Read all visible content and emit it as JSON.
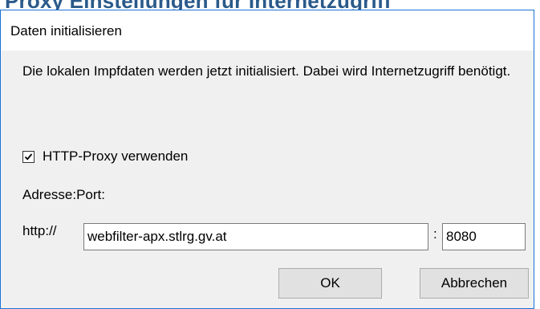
{
  "background": {
    "heading": "Proxy Einstellungen für Internetzugriff"
  },
  "dialog": {
    "title": "Daten initialisieren",
    "message": "Die lokalen Impfdaten werden jetzt initialisiert. Dabei wird Internetzugriff benötigt.",
    "proxy_checkbox": {
      "label": "HTTP-Proxy verwenden",
      "checked": true
    },
    "address_label": "Adresse:Port:",
    "scheme_label": "http://",
    "host_value": "webfilter-apx.stlrg.gv.at",
    "port_separator": ":",
    "port_value": "8080",
    "ok_label": "OK",
    "cancel_label": "Abbrechen"
  },
  "colors": {
    "dialog_border": "#1a73d6",
    "dialog_background": "#f0f0f0",
    "heading_color": "#2a5a8a"
  },
  "icons": {
    "checkbox_mark": "checkmark-icon"
  }
}
